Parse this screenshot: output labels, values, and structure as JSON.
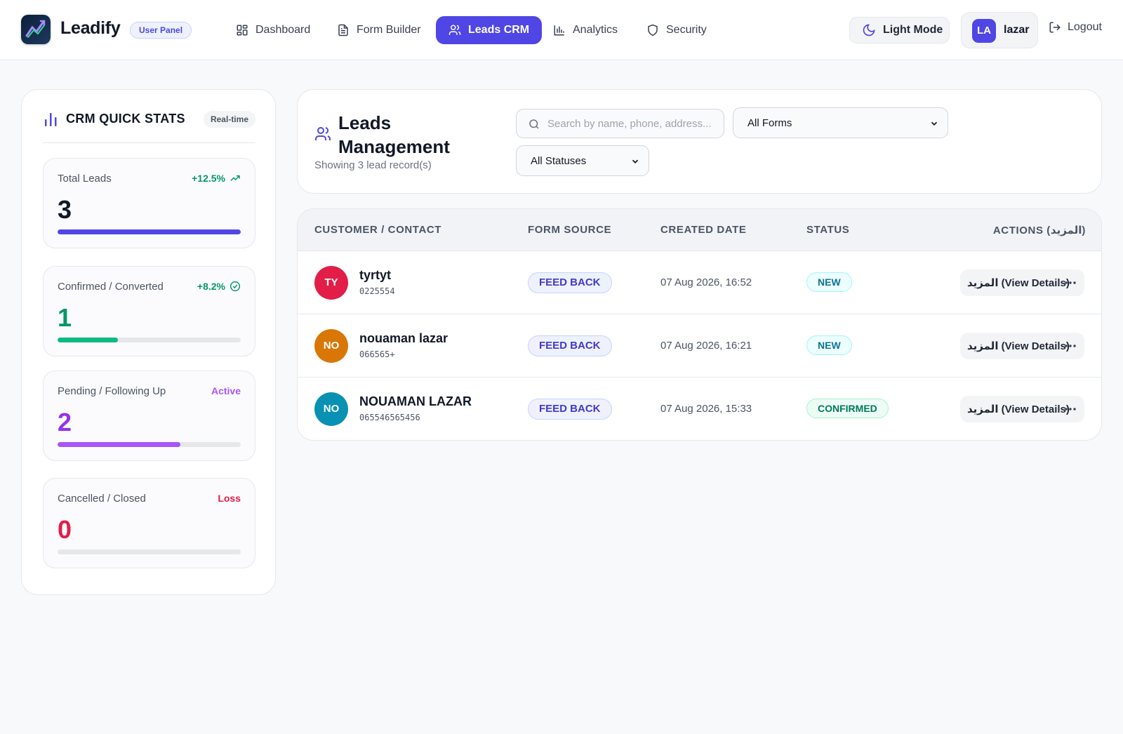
{
  "brand": {
    "name": "Leadify",
    "badge": "User Panel"
  },
  "nav": [
    {
      "label": "Dashboard",
      "icon": "dashboard-grid-icon",
      "active": false
    },
    {
      "label": "Form Builder",
      "icon": "document-icon",
      "active": false
    },
    {
      "label": "Leads CRM",
      "icon": "users-icon",
      "active": true
    },
    {
      "label": "Analytics",
      "icon": "bar-chart-icon",
      "active": false
    },
    {
      "label": "Security",
      "icon": "shield-icon",
      "active": false
    }
  ],
  "header_right": {
    "mode_label": "Light Mode",
    "user_initials": "LA",
    "user_name": "lazar",
    "logout_label": "Logout"
  },
  "stats": {
    "title": "CRM QUICK STATS",
    "badge": "Real-time",
    "items": [
      {
        "label": "Total Leads",
        "delta": "+12.5%",
        "delta_icon": "trending-up-icon",
        "value": "3",
        "fill_fraction": 1.0,
        "value_color": "#111827",
        "delta_color": "#059669",
        "fill_color": "#4f46e5"
      },
      {
        "label": "Confirmed / Converted",
        "delta": "+8.2%",
        "delta_icon": "check-circle-icon",
        "value": "1",
        "fill_fraction": 0.33,
        "value_color": "#059669",
        "delta_color": "#059669",
        "fill_color": "#10b981"
      },
      {
        "label": "Pending / Following Up",
        "delta": "Active",
        "delta_icon": "",
        "value": "2",
        "fill_fraction": 0.67,
        "value_color": "#9333ea",
        "delta_color": "#a855f7",
        "fill_color": "#a855f7"
      },
      {
        "label": "Cancelled / Closed",
        "delta": "Loss",
        "delta_icon": "",
        "value": "0",
        "fill_fraction": 0.0,
        "value_color": "#e11d48",
        "delta_color": "#e11d48",
        "fill_color": "#e11d48"
      }
    ]
  },
  "leads_header": {
    "title": "Leads Management",
    "subtitle": "Showing 3 lead record(s)",
    "search_placeholder": "Search by name, phone, address...",
    "form_filter": "All Forms",
    "status_filter": "All Statuses"
  },
  "table": {
    "columns": [
      "CUSTOMER / CONTACT",
      "FORM SOURCE",
      "CREATED DATE",
      "STATUS",
      "ACTIONS (المزيد)"
    ],
    "rows": [
      {
        "initials": "TY",
        "avatar_color": "#e11d48",
        "name": "tyrtyt",
        "phone": "0225554",
        "source": "FEED BACK",
        "created": "07 Aug 2026, 16:52",
        "status": "NEW",
        "status_kind": "new",
        "action": "المزيد (View Details)"
      },
      {
        "initials": "NO",
        "avatar_color": "#d97706",
        "name": "nouaman lazar",
        "phone": "066565+",
        "source": "FEED BACK",
        "created": "07 Aug 2026, 16:21",
        "status": "NEW",
        "status_kind": "new",
        "action": "المزيد (View Details)"
      },
      {
        "initials": "NO",
        "avatar_color": "#0891b2",
        "name": "NOUAMAN LAZAR",
        "phone": "065546565456",
        "source": "FEED BACK",
        "created": "07 Aug 2026, 15:33",
        "status": "CONFIRMED",
        "status_kind": "confirmed",
        "action": "المزيد (View Details)"
      }
    ]
  },
  "colors": {
    "accent": "#4f46e5",
    "page_bg": "#f8f9fb"
  }
}
